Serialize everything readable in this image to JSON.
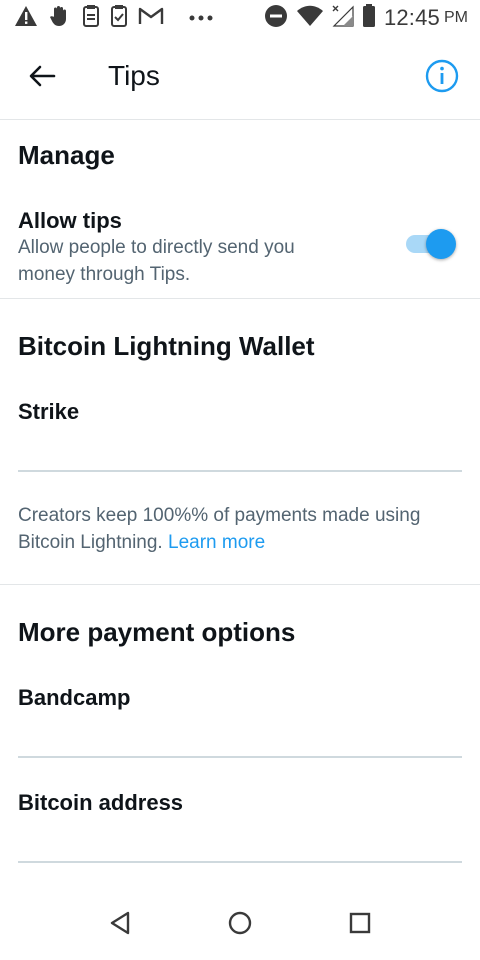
{
  "status_bar": {
    "time": "12:45",
    "ampm": "PM",
    "icons": [
      "warning-icon",
      "hand-icon",
      "clipboard-icon",
      "clipboard-check-icon",
      "gmail-icon",
      "more-dots-icon",
      "do-not-disturb-icon",
      "wifi-icon",
      "signal-icon",
      "battery-icon"
    ]
  },
  "header": {
    "title": "Tips"
  },
  "manage": {
    "title": "Manage",
    "allow_tips_label": "Allow tips",
    "allow_tips_desc_line1": "Allow people to directly send you",
    "allow_tips_desc_line2": "money through Tips.",
    "allow_tips_enabled": true
  },
  "bitcoin": {
    "title": "Bitcoin Lightning Wallet",
    "strike_label": "Strike",
    "strike_value": "",
    "info_line1": "Creators keep 100%% of payments made using",
    "info_line2": "Bitcoin Lightning.",
    "learn_more": "Learn more"
  },
  "more_payment": {
    "title": "More payment options",
    "bandcamp_label": "Bandcamp",
    "bandcamp_value": "",
    "bitcoin_address_label": "Bitcoin address",
    "bitcoin_address_value": ""
  },
  "colors": {
    "accent": "#1d9bf0",
    "toggle_track": "#a9d8f7",
    "text_primary": "#0f1419",
    "text_secondary": "#536471"
  }
}
